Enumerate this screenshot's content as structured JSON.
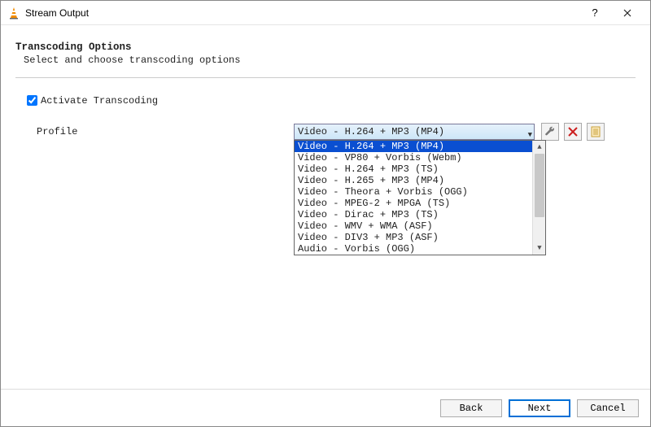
{
  "window": {
    "title": "Stream Output"
  },
  "heading": {
    "title": "Transcoding Options",
    "subtitle": "Select and choose transcoding options"
  },
  "transcoding": {
    "activate_label": "Activate Transcoding",
    "activate_checked": true
  },
  "profile": {
    "label": "Profile",
    "selected": "Video - H.264 + MP3 (MP4)",
    "options": [
      "Video - H.264 + MP3 (MP4)",
      "Video - VP80 + Vorbis (Webm)",
      "Video - H.264 + MP3 (TS)",
      "Video - H.265 + MP3 (MP4)",
      "Video - Theora + Vorbis (OGG)",
      "Video - MPEG-2 + MPGA (TS)",
      "Video - Dirac + MP3 (TS)",
      "Video - WMV + WMA (ASF)",
      "Video - DIV3 + MP3 (ASF)",
      "Audio - Vorbis (OGG)"
    ]
  },
  "footer": {
    "back": "Back",
    "next": "Next",
    "cancel": "Cancel"
  }
}
